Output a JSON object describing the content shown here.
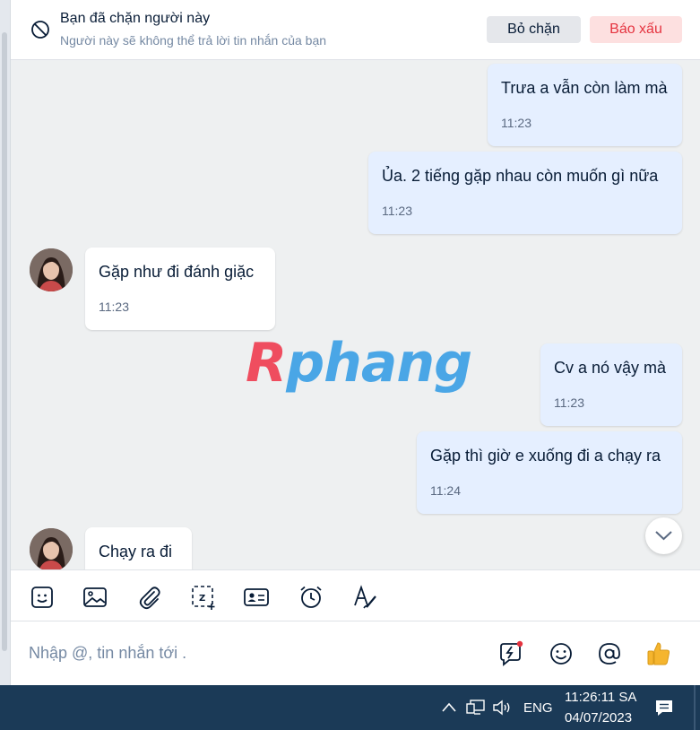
{
  "banner": {
    "title": "Bạn đã chặn người này",
    "subtitle": "Người này sẽ không thể trả lời tin nhắn của bạn",
    "unblock_label": "Bỏ chặn",
    "report_label": "Báo xấu"
  },
  "messages": [
    {
      "sender": "me",
      "text": "Trưa a vẫn còn làm mà",
      "time": "11:23"
    },
    {
      "sender": "me",
      "text": "Ủa. 2 tiếng gặp nhau còn muốn gì nữa",
      "time": "11:23"
    },
    {
      "sender": "contact",
      "text": "Gặp như đi đánh giặc",
      "time": "11:23"
    },
    {
      "sender": "me",
      "text": "Cv a nó vậy mà",
      "time": "11:23"
    },
    {
      "sender": "me",
      "text": "Gặp thì giờ e xuống đi a chạy ra",
      "time": "11:24"
    },
    {
      "sender": "contact",
      "text": "Chạy ra đi",
      "time": ""
    }
  ],
  "watermark": {
    "first": "R",
    "rest": "phang"
  },
  "toolbar": [
    "sticker-icon",
    "image-icon",
    "attachment-icon",
    "screenshot-icon",
    "contact-card-icon",
    "reminder-icon",
    "text-format-icon"
  ],
  "composer": {
    "placeholder": "Nhập @, tin nhắn tới ."
  },
  "taskbar": {
    "language": "ENG",
    "time": "11:26:11 SA",
    "date": "04/07/2023"
  },
  "colors": {
    "mine_bubble": "#e5efff",
    "theirs_bubble": "#ffffff",
    "report_red": "#e5333f",
    "taskbar": "#1b3a57",
    "like_yellow": "#f5b52e"
  }
}
